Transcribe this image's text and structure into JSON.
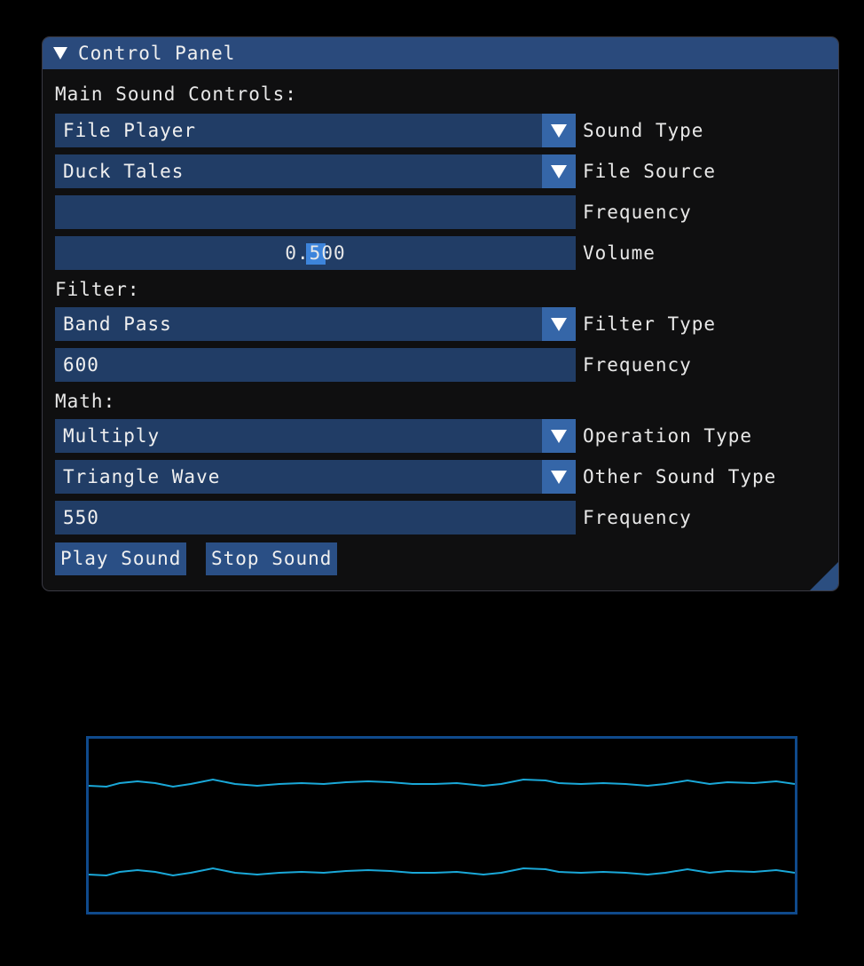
{
  "panel": {
    "title": "Control Panel",
    "main_section_label": "Main Sound Controls:",
    "sound_type": {
      "value": "File Player",
      "label": "Sound Type"
    },
    "file_source": {
      "value": "Duck Tales",
      "label": "File Source"
    },
    "main_frequency": {
      "value": "",
      "label": "Frequency"
    },
    "volume": {
      "value": "0.500",
      "label": "Volume",
      "level": 0.5
    },
    "filter_section_label": "Filter:",
    "filter_type": {
      "value": "Band Pass",
      "label": "Filter Type"
    },
    "filter_frequency": {
      "value": "600",
      "label": "Frequency"
    },
    "math_section_label": "Math:",
    "operation_type": {
      "value": "Multiply",
      "label": "Operation Type"
    },
    "other_sound_type": {
      "value": "Triangle Wave",
      "label": "Other Sound Type"
    },
    "other_frequency": {
      "value": "550",
      "label": "Frequency"
    },
    "play_label": "Play Sound",
    "stop_label": "Stop Sound"
  },
  "colors": {
    "window_bg": "#0f0f10",
    "title_bg": "#2a4a7c",
    "frame_bg": "#213d66",
    "button_bg": "#2a4f85",
    "slider_grab": "#3d84db",
    "scope_border": "#0f4a8c",
    "waveform": "#1aa8d8"
  },
  "icons": {
    "collapse": "triangle-down-icon",
    "dropdown": "triangle-down-icon",
    "resize": "resize-grip-icon"
  }
}
